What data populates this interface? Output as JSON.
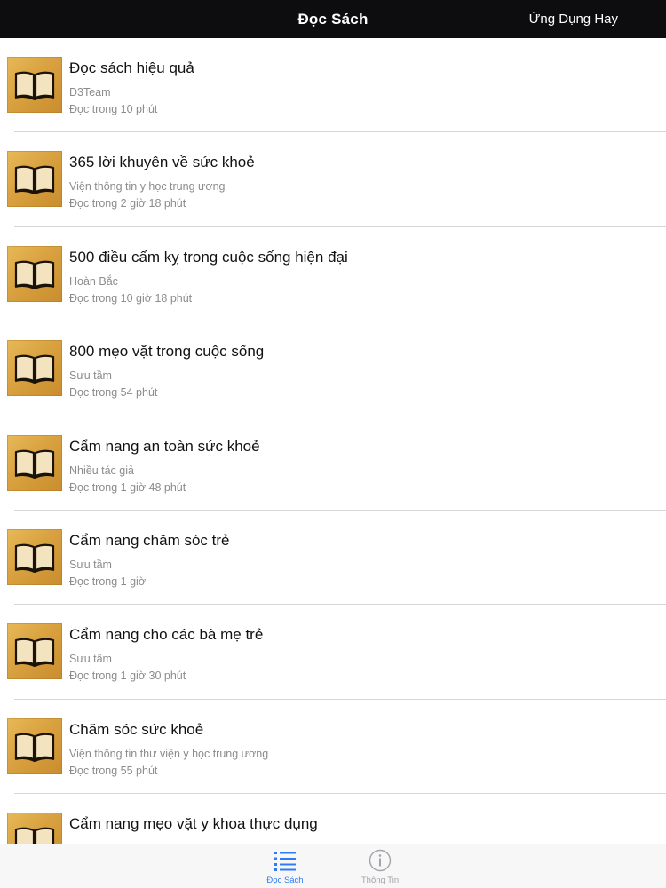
{
  "navbar": {
    "title": "Đọc Sách",
    "right_link": "Ứng Dụng Hay"
  },
  "books": [
    {
      "title": "Đọc sách hiệu quả",
      "author": "D3Team",
      "read_time": "Đọc trong 10 phút"
    },
    {
      "title": "365 lời khuyên về sức khoẻ",
      "author": "Viện thông tin y học trung ương",
      "read_time": "Đọc trong 2 giờ 18 phút"
    },
    {
      "title": "500 điều cấm kỵ trong cuộc sống hiện đại",
      "author": "Hoàn Bắc",
      "read_time": "Đọc trong 10 giờ 18 phút"
    },
    {
      "title": "800 mẹo vặt trong cuộc sống",
      "author": "Sưu tầm",
      "read_time": "Đọc trong 54 phút"
    },
    {
      "title": "Cẩm nang an toàn sức khoẻ",
      "author": "Nhiều tác giả",
      "read_time": "Đọc trong 1 giờ 48 phút"
    },
    {
      "title": "Cẩm nang chăm sóc trẻ",
      "author": "Sưu tầm",
      "read_time": "Đọc trong 1 giờ"
    },
    {
      "title": "Cẩm nang cho các bà mẹ trẻ",
      "author": "Sưu tầm",
      "read_time": "Đọc trong 1 giờ 30 phút"
    },
    {
      "title": "Chăm sóc sức khoẻ",
      "author": "Viện thông tin thư viện y học trung ương",
      "read_time": "Đọc trong 55 phút"
    },
    {
      "title": "Cẩm nang mẹo vặt y khoa thực dụng",
      "author": "",
      "read_time": ""
    }
  ],
  "tabbar": {
    "tabs": [
      {
        "label": "Đọc Sách",
        "icon": "list-icon",
        "active": true
      },
      {
        "label": "Thông Tin",
        "icon": "info-icon",
        "active": false
      }
    ]
  },
  "colors": {
    "navbar_bg": "#0d0d0f",
    "accent": "#2f7bf5",
    "cover_gold": "#d9a13f"
  }
}
